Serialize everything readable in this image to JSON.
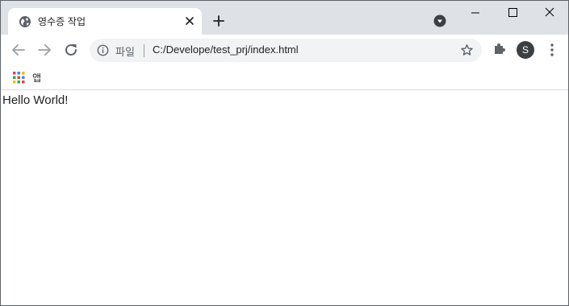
{
  "browser": {
    "tab": {
      "title": "영수증 작업",
      "favicon": "globe-icon",
      "close_icon": "close-icon"
    },
    "new_tab_icon": "plus-icon",
    "tab_search_icon": "chevron-down-circle-icon",
    "window_controls": [
      "minimize-icon",
      "maximize-icon",
      "close-icon"
    ]
  },
  "toolbar": {
    "back_icon": "arrow-left-icon",
    "forward_icon": "arrow-right-icon",
    "reload_icon": "reload-icon",
    "omnibox": {
      "info_icon": "info-icon",
      "scheme_label": "파일",
      "url": "C:/Develope/test_prj/index.html",
      "bookmark_icon": "star-icon"
    },
    "extensions_icon": "puzzle-icon",
    "profile_initial": "S",
    "menu_icon": "kebab-menu-icon"
  },
  "bookmarks_bar": {
    "apps_label": "앱",
    "apps_icon": "apps-grid-icon"
  },
  "page": {
    "content": "Hello World!"
  },
  "colors": {
    "tab_strip": "#dee1e6",
    "omnibox_bg": "#f1f3f4",
    "avatar_bg": "#3c4043",
    "text": "#202124",
    "icon": "#5f6368"
  }
}
